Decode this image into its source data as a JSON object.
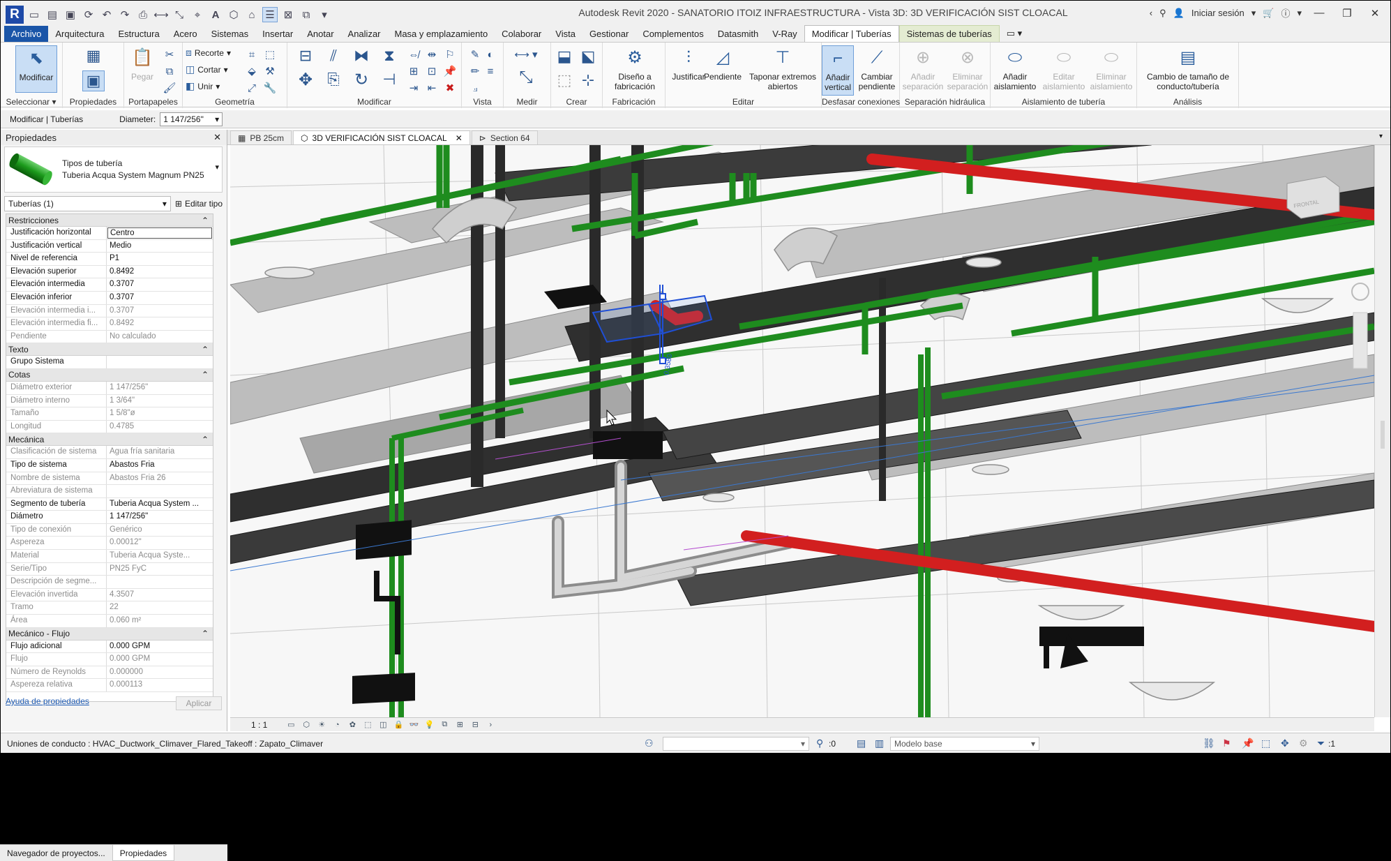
{
  "app": {
    "title": "Autodesk Revit 2020 - SANATORIO ITOIZ INFRAESTRUCTURA - Vista 3D: 3D VERIFICACIÓN SIST CLOACAL",
    "sign_in": "Iniciar sesión"
  },
  "menu_tabs": [
    "Archivo",
    "Arquitectura",
    "Estructura",
    "Acero",
    "Sistemas",
    "Insertar",
    "Anotar",
    "Analizar",
    "Masa y emplazamiento",
    "Colaborar",
    "Vista",
    "Gestionar",
    "Complementos",
    "Datasmith",
    "V-Ray",
    "Modificar | Tuberías",
    "Sistemas de tuberías"
  ],
  "ribbon": {
    "panels": {
      "seleccionar": "Seleccionar",
      "propiedades": "Propiedades",
      "portapapeles": "Portapapeles",
      "geometria": "Geometría",
      "modificar": "Modificar",
      "vista": "Vista",
      "medir": "Medir",
      "crear": "Crear",
      "fabricacion": "Fabricación",
      "editar": "Editar",
      "desfasar": "Desfasar conexiones",
      "separacion": "Separación hidráulica",
      "aislamiento": "Aislamiento de tubería",
      "analisis": "Análisis"
    },
    "buttons": {
      "modificar": "Modificar",
      "pegar": "Pegar",
      "recorte": "Recorte",
      "cortar": "Cortar",
      "unir": "Unir",
      "diseno": "Diseño a fabricación",
      "justificar": "Justificar",
      "pendiente": "Pendiente",
      "taponar": "Taponar extremos abiertos",
      "anadir_vertical": "Añadir vertical",
      "cambiar_pendiente": "Cambiar pendiente",
      "anadir_separacion": "Añadir separación",
      "eliminar_separacion": "Eliminar separación",
      "anadir_aislamiento": "Añadir aislamiento",
      "editar_aislamiento": "Editar aislamiento",
      "eliminar_aislamiento": "Eliminar aislamiento",
      "cambio_tamano": "Cambio de tamaño de conducto/tubería"
    }
  },
  "options_bar": {
    "context": "Modificar | Tuberías",
    "diameter_label": "Diameter:",
    "diameter_value": "1 147/256\""
  },
  "properties": {
    "title": "Propiedades",
    "type_category": "Tipos de tubería",
    "type_name": "Tuberia Acqua System Magnum PN25",
    "filter": "Tuberías (1)",
    "edit_type": "Editar tipo",
    "help": "Ayuda de propiedades",
    "apply": "Aplicar",
    "groups": [
      {
        "name": "Restricciones",
        "rows": [
          {
            "name": "Justificación horizontal",
            "value": "Centro",
            "ro": false,
            "edit": true
          },
          {
            "name": "Justificación vertical",
            "value": "Medio",
            "ro": false
          },
          {
            "name": "Nivel de referencia",
            "value": "P1",
            "ro": false
          },
          {
            "name": "Elevación superior",
            "value": "0.8492",
            "ro": false
          },
          {
            "name": "Elevación intermedia",
            "value": "0.3707",
            "ro": false
          },
          {
            "name": "Elevación inferior",
            "value": "0.3707",
            "ro": false
          },
          {
            "name": "Elevación intermedia i...",
            "value": "0.3707",
            "ro": true
          },
          {
            "name": "Elevación intermedia fi...",
            "value": "0.8492",
            "ro": true
          },
          {
            "name": "Pendiente",
            "value": "No calculado",
            "ro": true
          }
        ]
      },
      {
        "name": "Texto",
        "rows": [
          {
            "name": "Grupo Sistema",
            "value": "",
            "ro": false
          }
        ]
      },
      {
        "name": "Cotas",
        "rows": [
          {
            "name": "Diámetro exterior",
            "value": "1 147/256\"",
            "ro": true
          },
          {
            "name": "Diámetro interno",
            "value": "1 3/64\"",
            "ro": true
          },
          {
            "name": "Tamaño",
            "value": "1 5/8\"ø",
            "ro": true
          },
          {
            "name": "Longitud",
            "value": "0.4785",
            "ro": true
          }
        ]
      },
      {
        "name": "Mecánica",
        "rows": [
          {
            "name": "Clasificación de sistema",
            "value": "Agua fría sanitaria",
            "ro": true
          },
          {
            "name": "Tipo de sistema",
            "value": "Abastos Fria",
            "ro": false
          },
          {
            "name": "Nombre de sistema",
            "value": "Abastos Fria 26",
            "ro": true
          },
          {
            "name": "Abreviatura de sistema",
            "value": "",
            "ro": true
          },
          {
            "name": "Segmento de tubería",
            "value": "Tuberia Acqua System ...",
            "ro": false
          },
          {
            "name": "Diámetro",
            "value": "1 147/256\"",
            "ro": false
          },
          {
            "name": "Tipo de conexión",
            "value": "Genérico",
            "ro": true
          },
          {
            "name": "Aspereza",
            "value": "0.00012\"",
            "ro": true
          },
          {
            "name": "Material",
            "value": "Tuberia Acqua Syste...",
            "ro": true
          },
          {
            "name": "Serie/Tipo",
            "value": "PN25  FyC",
            "ro": true
          },
          {
            "name": "Descripción de segme...",
            "value": "",
            "ro": true
          },
          {
            "name": "Elevación invertida",
            "value": "4.3507",
            "ro": true
          },
          {
            "name": "Tramo",
            "value": "22",
            "ro": true
          },
          {
            "name": "Área",
            "value": "0.060 m²",
            "ro": true
          }
        ]
      },
      {
        "name": "Mecánico - Flujo",
        "rows": [
          {
            "name": "Flujo adicional",
            "value": "0.000 GPM",
            "ro": false
          },
          {
            "name": "Flujo",
            "value": "0.000 GPM",
            "ro": true
          },
          {
            "name": "Número de Reynolds",
            "value": "0.000000",
            "ro": true
          },
          {
            "name": "Aspereza relativa",
            "value": "0.000113",
            "ro": true
          }
        ]
      }
    ]
  },
  "browser_tabs": [
    "Navegador de proyectos...",
    "Propiedades"
  ],
  "view_tabs": [
    {
      "label": "PB 25cm",
      "active": false
    },
    {
      "label": "3D VERIFICACIÓN SIST CLOACAL",
      "active": true
    },
    {
      "label": "Section 64",
      "active": false
    }
  ],
  "view_controls": {
    "scale": "1 : 1"
  },
  "status_bar": {
    "message": "Uniones de conducto : HVAC_Ductwork_Climaver_Flared_Takeoff : Zapato_Climaver",
    "workset_count": ":0",
    "model": "Modelo base",
    "filter_count": ":1"
  },
  "viewport": {
    "dimension_label": "0.3580",
    "tag_text": "FRONTAL"
  },
  "colors": {
    "green_pipe": "#1f8f1f",
    "red_pipe": "#d42020",
    "dark_duct": "#2e2e2e",
    "selection": "#1f4fd6",
    "file_tab": "#1a55a8",
    "context_tab": "#e4ecd2"
  }
}
